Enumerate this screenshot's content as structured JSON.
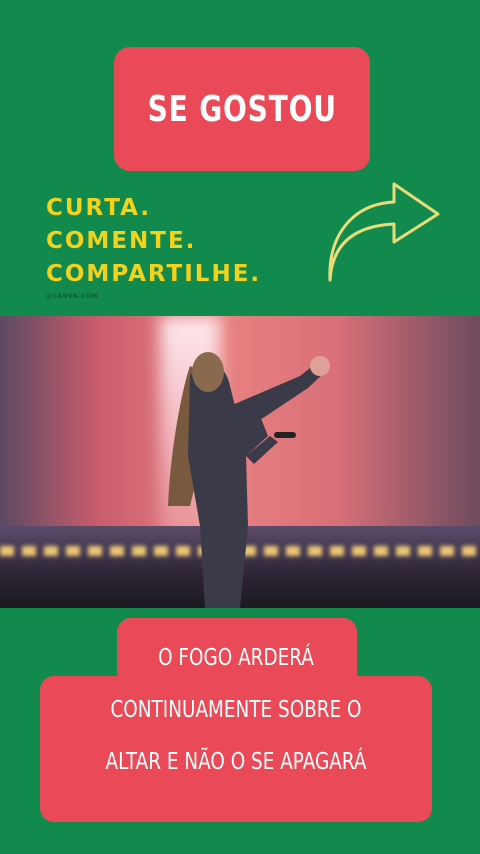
{
  "banner": {
    "title": "SE GOSTOU"
  },
  "cta": {
    "line1": "CURTA.",
    "line2": "COMENTE.",
    "line3": "COMPARTILHE.",
    "credit": "@CANVA.COM"
  },
  "icons": {
    "share": "share-arrow-icon"
  },
  "video": {
    "description_icon": "performer-frame"
  },
  "caption": {
    "line1": "O FOGO ARDERÁ",
    "line2": "CONTINUAMENTE SOBRE O",
    "line3": "ALTAR E NÃO O SE APAGARÁ"
  },
  "colors": {
    "background": "#138a4d",
    "accent": "#ea4a57",
    "yellow": "#f3d21c"
  }
}
